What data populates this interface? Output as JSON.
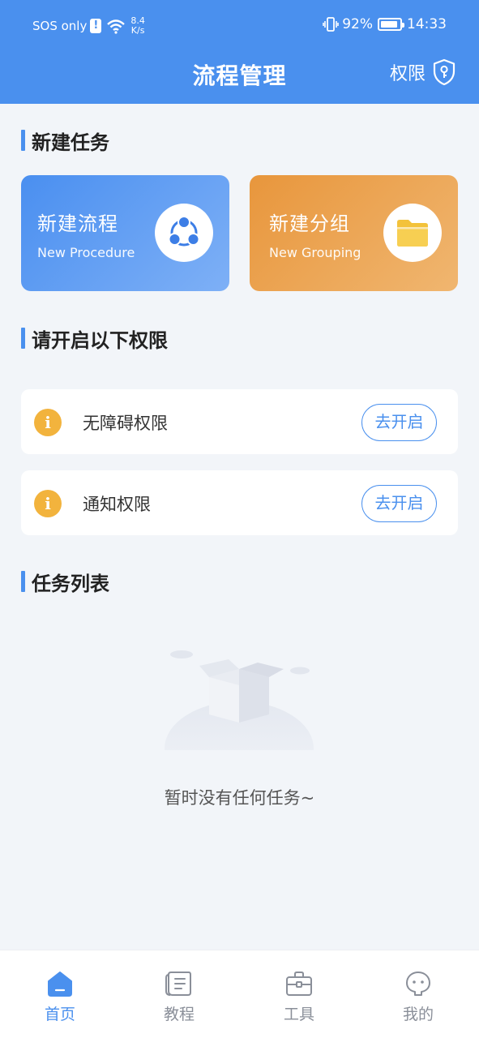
{
  "status_bar": {
    "carrier": "SOS only",
    "alert": "!",
    "speed_value": "8.4",
    "speed_unit": "K/s",
    "battery": "92%",
    "time": "14:33"
  },
  "header": {
    "title": "流程管理",
    "permission_label": "权限"
  },
  "sections": {
    "new_task": "新建任务",
    "permissions": "请开启以下权限",
    "task_list": "任务列表"
  },
  "cards": [
    {
      "title": "新建流程",
      "subtitle": "New Procedure",
      "icon": "share-nodes-icon",
      "color": "#4a8ff0"
    },
    {
      "title": "新建分组",
      "subtitle": "New Grouping",
      "icon": "folder-icon",
      "color": "#e8963c"
    }
  ],
  "permission_items": [
    {
      "label": "无障碍权限",
      "button": "去开启",
      "icon": "info-icon"
    },
    {
      "label": "通知权限",
      "button": "去开启",
      "icon": "info-icon"
    }
  ],
  "empty_state": {
    "text": "暂时没有任何任务~",
    "icon": "empty-box-icon"
  },
  "tabs": [
    {
      "label": "首页",
      "icon": "home-icon",
      "active": true
    },
    {
      "label": "教程",
      "icon": "tutorial-icon",
      "active": false
    },
    {
      "label": "工具",
      "icon": "toolbox-icon",
      "active": false
    },
    {
      "label": "我的",
      "icon": "profile-icon",
      "active": false
    }
  ],
  "colors": {
    "primary": "#4a90ee",
    "orange": "#e8963c",
    "info": "#f2b33d"
  }
}
